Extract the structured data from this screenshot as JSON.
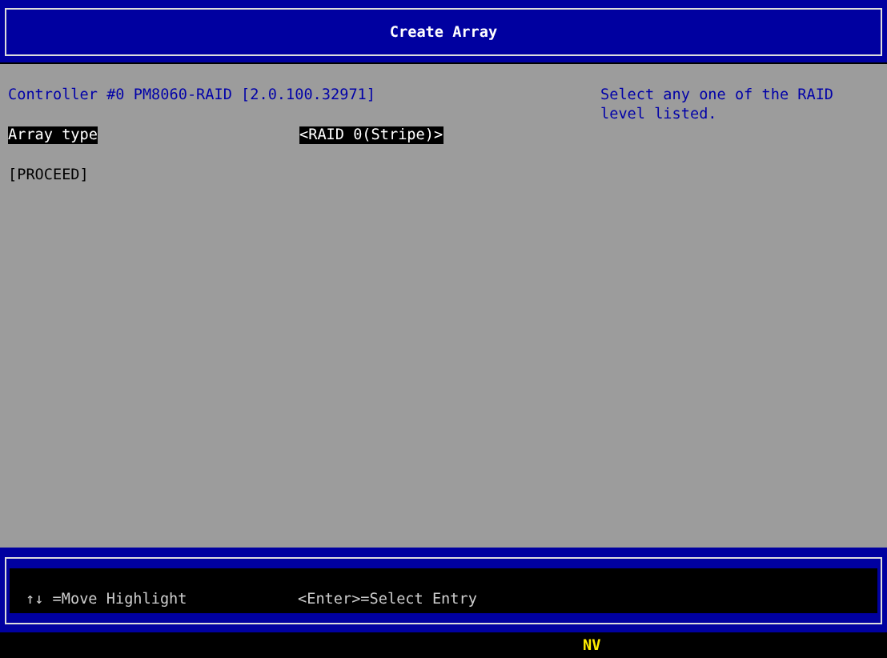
{
  "window": {
    "title": "Create Array"
  },
  "controller": "Controller #0 PM8060-RAID [2.0.100.32971]",
  "fields": [
    {
      "label": "Array type",
      "value": "<RAID 0(Stripe)>",
      "selected": true
    }
  ],
  "actions": [
    {
      "label": "[PROCEED]",
      "selected": false
    }
  ],
  "help": "Select any one of the RAID level listed.",
  "key_hints": [
    {
      "arrows": "↑↓",
      "text": "=Move Highlight"
    },
    {
      "text": "<Enter>=Select Entry"
    }
  ],
  "status_bar": {
    "indicator": "NV"
  }
}
